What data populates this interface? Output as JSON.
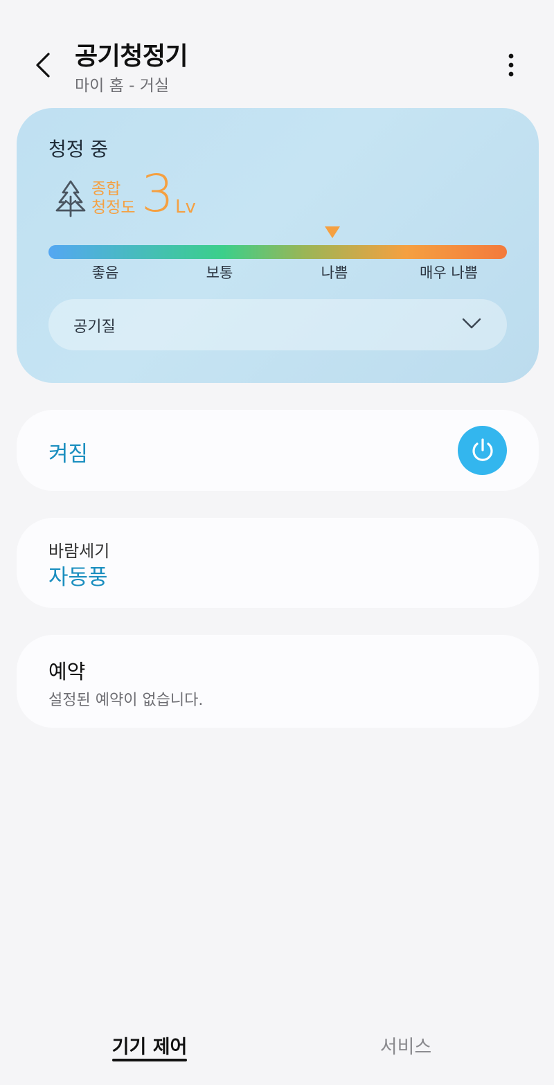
{
  "header": {
    "title": "공기청정기",
    "subtitle": "마이 홈 - 거실"
  },
  "air_quality": {
    "status": "청정 중",
    "label_line1": "종합",
    "label_line2": "청정도",
    "value": "3",
    "unit": "Lv",
    "level_fraction": 0.62,
    "scale": [
      "좋음",
      "보통",
      "나쁨",
      "매우 나쁨"
    ],
    "dropdown_label": "공기질"
  },
  "power": {
    "label": "켜짐",
    "state": "on"
  },
  "wind": {
    "label": "바람세기",
    "value": "자동풍"
  },
  "schedule": {
    "title": "예약",
    "subtitle": "설정된 예약이 없습니다."
  },
  "tabs": [
    {
      "label": "기기 제어",
      "active": true
    },
    {
      "label": "서비스",
      "active": false
    }
  ],
  "colors": {
    "accent": "#1a8ebf",
    "power_button": "#33b6ee",
    "air_quality_orange": "#f5a041"
  },
  "icons": {
    "back": "chevron-left-icon",
    "more": "more-vertical-icon",
    "tree": "tree-icon",
    "dropdown": "chevron-down-icon",
    "power": "power-icon"
  }
}
